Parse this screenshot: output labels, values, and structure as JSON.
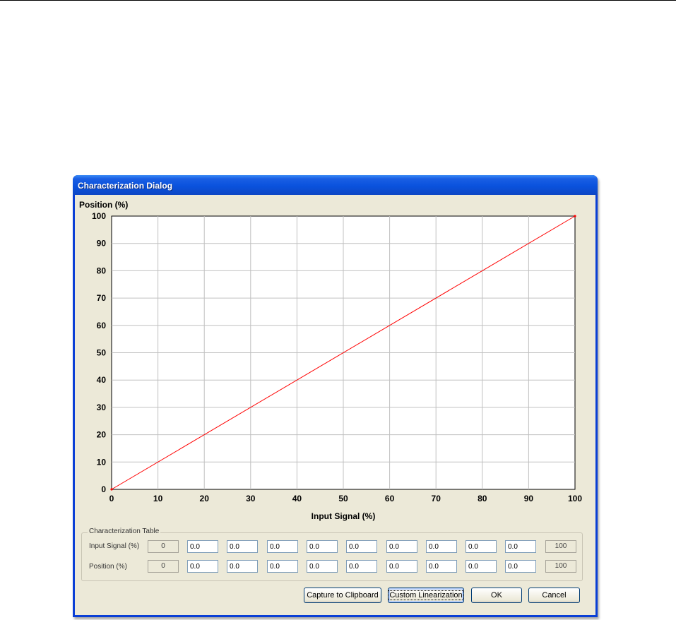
{
  "dialog": {
    "title": "Characterization Dialog"
  },
  "chart_data": {
    "type": "line",
    "ylabel": "Position (%)",
    "xlabel": "Input Signal (%)",
    "xlim": [
      0,
      100
    ],
    "ylim": [
      0,
      100
    ],
    "x_ticks": [
      0,
      10,
      20,
      30,
      40,
      50,
      60,
      70,
      80,
      90,
      100
    ],
    "y_ticks": [
      0,
      10,
      20,
      30,
      40,
      50,
      60,
      70,
      80,
      90,
      100
    ],
    "grid": true,
    "series": [
      {
        "x": [
          0,
          100
        ],
        "y": [
          0,
          100
        ],
        "color": "#ff0000"
      }
    ]
  },
  "table": {
    "legend": "Characterization Table",
    "rows": [
      {
        "label": "Input Signal (%)",
        "first": "0",
        "values": [
          "0.0",
          "0.0",
          "0.0",
          "0.0",
          "0.0",
          "0.0",
          "0.0",
          "0.0",
          "0.0"
        ],
        "last": "100"
      },
      {
        "label": "Position (%)",
        "first": "0",
        "values": [
          "0.0",
          "0.0",
          "0.0",
          "0.0",
          "0.0",
          "0.0",
          "0.0",
          "0.0",
          "0.0"
        ],
        "last": "100"
      }
    ]
  },
  "buttons": {
    "capture": "Capture to Clipboard",
    "custom": "Custom Linearization",
    "ok": "OK",
    "cancel": "Cancel"
  }
}
